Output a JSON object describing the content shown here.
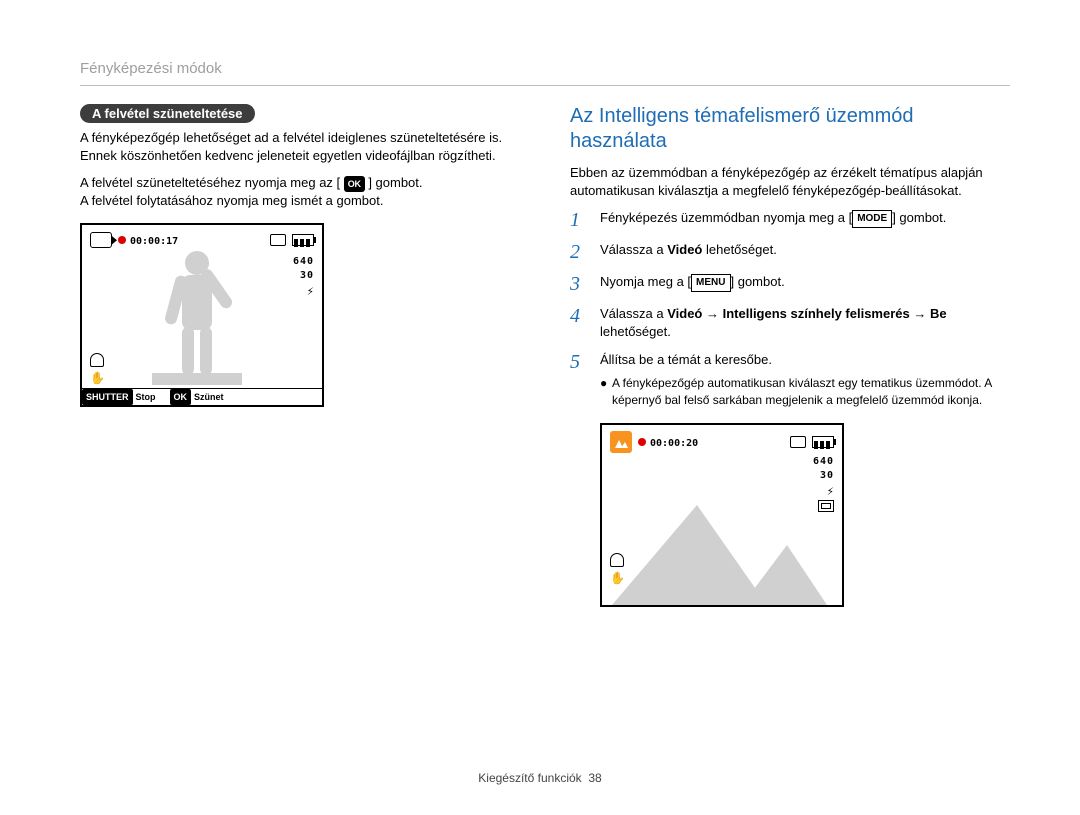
{
  "breadcrumb": "Fényképezési módok",
  "left": {
    "pill": "A felvétel szüneteltetése",
    "para1": "A fényképezőgép lehetőséget ad a felvétel ideiglenes szüneteltetésére is. Ennek köszönhetően kedvenc jeleneteit egyetlen videofájlban rögzítheti.",
    "para2_pre": "A felvétel szüneteltetéséhez nyomja meg az [",
    "para2_icon": "OK",
    "para2_post": "] gombot.",
    "para3": "A felvétel folytatásához nyomja meg ismét a gombot.",
    "lcd": {
      "timecode": "00:00:17",
      "size": "640",
      "fps": "30",
      "bottom_shutter_btn": "SHUTTER",
      "bottom_stop": "Stop",
      "bottom_ok_btn": "OK",
      "bottom_pause": "Szünet"
    }
  },
  "right": {
    "title": "Az Intelligens témafelismerő üzemmód használata",
    "intro": "Ebben az üzemmódban a fényképezőgép az érzékelt tématípus alapján automatikusan kiválasztja a megfelelő fényképezőgép-beállításokat.",
    "steps": {
      "s1_pre": "Fényképezés üzemmódban nyomja meg a [",
      "s1_btn": "MODE",
      "s1_post": "] gombot.",
      "s2_pre": "Válassza a ",
      "s2_bold": "Videó",
      "s2_post": " lehetőséget.",
      "s3_pre": "Nyomja meg a [",
      "s3_btn": "MENU",
      "s3_post": "] gombot.",
      "s4_pre": "Válassza a ",
      "s4_b1": "Videó",
      "s4_arrow1": " → ",
      "s4_b2": "Intelligens színhely felismerés",
      "s4_arrow2": " → ",
      "s4_b3": "Be",
      "s4_post": " lehetőséget.",
      "s5": "Állítsa be a témát a keresőbe.",
      "s5_bullet": "A fényképezőgép automatikusan kiválaszt egy tematikus üzemmódot. A képernyő bal felső sarkában megjelenik a megfelelő üzemmód ikonja."
    },
    "lcd": {
      "timecode": "00:00:20",
      "size": "640",
      "fps": "30"
    }
  },
  "footer": {
    "label": "Kiegészítő funkciók",
    "page": "38"
  }
}
